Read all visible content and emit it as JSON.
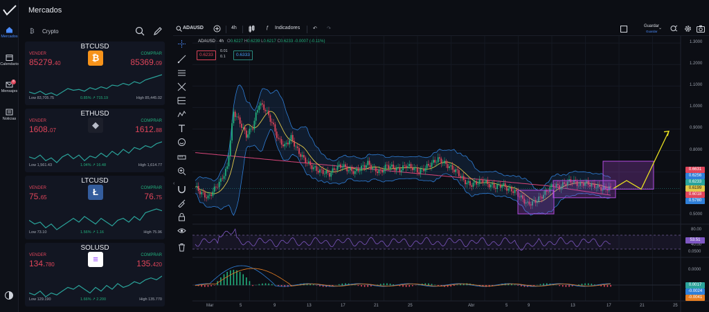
{
  "app": {
    "page_title": "Mercados"
  },
  "rail": {
    "items": [
      {
        "label": "Mercados",
        "icon": "home-icon",
        "active": true
      },
      {
        "label": "Calendario",
        "icon": "calendar-icon"
      },
      {
        "label": "Mensajes",
        "icon": "mail-icon",
        "badge": "8"
      },
      {
        "label": "Noticias",
        "icon": "news-icon"
      }
    ]
  },
  "panel": {
    "category_icon": "bitcoin-b-icon",
    "category_label": "Crypto",
    "cards": [
      {
        "symbol": "BTCUSD",
        "sell_label": "VENDER",
        "buy_label": "COMPRAR",
        "sell_main": "85279.",
        "sell_tail": "40",
        "buy_main": "85369.",
        "buy_tail": "09",
        "low": "Low 83,705.75",
        "change": "0.85% ↗ 715.19",
        "high": "High 85,445.02",
        "coin_color": "#f7931a",
        "coin_icon": "bitcoin-icon",
        "spark": [
          30,
          32,
          29,
          33,
          31,
          34,
          30,
          26,
          28,
          27,
          29,
          25,
          27,
          24,
          26,
          22,
          23,
          20,
          22,
          18,
          20,
          16,
          14,
          12,
          10
        ]
      },
      {
        "symbol": "ETHUSD",
        "sell_label": "VENDER",
        "buy_label": "COMPRAR",
        "sell_main": "1608.",
        "sell_tail": "07",
        "buy_main": "1612.",
        "buy_tail": "88",
        "low": "Low 1,561.43",
        "change": "1.04% ↗ 16.48",
        "high": "High 1,614.77",
        "coin_color": "#1c1f2a",
        "coin_icon": "ethereum-icon",
        "spark": [
          26,
          28,
          24,
          30,
          27,
          32,
          26,
          23,
          28,
          24,
          30,
          25,
          27,
          22,
          26,
          20,
          24,
          18,
          22,
          16,
          18,
          14,
          16,
          12,
          10
        ]
      },
      {
        "symbol": "LTCUSD",
        "sell_label": "VENDER",
        "buy_label": "COMPRAR",
        "sell_main": "75.",
        "sell_tail": "65",
        "buy_main": "76.",
        "buy_tail": "75",
        "low": "Low 73.10",
        "change": "1.56% ↗ 1.16",
        "high": "High 75.96",
        "coin_color": "#345d9d",
        "coin_icon": "litecoin-icon",
        "spark": [
          22,
          26,
          24,
          30,
          26,
          32,
          28,
          24,
          20,
          24,
          18,
          22,
          26,
          20,
          24,
          28,
          22,
          20,
          24,
          18,
          22,
          14,
          12,
          10,
          12
        ]
      },
      {
        "symbol": "SOLUSD",
        "sell_label": "VENDER",
        "buy_label": "COMPRAR",
        "sell_main": "134.",
        "sell_tail": "780",
        "buy_main": "135.",
        "buy_tail": "420",
        "low": "Low 129.190",
        "change": "1.66% ↗ 2.200",
        "high": "High 135.770",
        "coin_color": "#ffffff",
        "coin_icon": "solana-icon",
        "spark": [
          28,
          30,
          26,
          32,
          28,
          30,
          26,
          22,
          24,
          20,
          24,
          28,
          22,
          26,
          20,
          24,
          18,
          22,
          20,
          16,
          18,
          14,
          12,
          14,
          10
        ]
      }
    ]
  },
  "toolbar": {
    "symbol": "ADAUSD",
    "interval": "4h",
    "indicators_label": "Indicadores",
    "save_label": "Guardar",
    "save_sub": "Guardar"
  },
  "chart_header": {
    "title": "ADAUSD · 4h",
    "o_label": "O",
    "o_value": "0.6227",
    "h_label": "H",
    "h_value": "0.6239",
    "l_label": "L",
    "l_value": "0.6217",
    "c_label": "C",
    "c_value": "0.6233",
    "change": "-0.0007 (-0.11%)",
    "sell_quote": "0.6233",
    "buy_quote": "0.6333",
    "spread_top": "0.01",
    "spread_bottom": "0.1"
  },
  "price_axis": {
    "ticks": [
      "1.3000",
      "1.2000",
      "1.1000",
      "1.0000",
      "0.9000",
      "0.8000",
      "0.7000",
      "0.6000",
      "0.5000"
    ],
    "tags": [
      {
        "value": "0.6631",
        "bg": "#e0455a",
        "fg": "#ffffff"
      },
      {
        "value": "0.6256",
        "bg": "#2f7fd8",
        "fg": "#ffffff"
      },
      {
        "value": "0.6233",
        "bg": "#2aa39a",
        "fg": "#ffffff"
      },
      {
        "value": "0.6199",
        "bg": "#e3c94a",
        "fg": "#1a1a1a"
      },
      {
        "value": "0.6018",
        "bg": "#e0455a",
        "fg": "#ffffff"
      },
      {
        "value": "0.5780",
        "bg": "#2f7fd8",
        "fg": "#ffffff"
      }
    ]
  },
  "rsi_axis": {
    "ticks": [
      "80.00",
      "40.00"
    ],
    "tag": {
      "value": "53.51",
      "bg": "#7e57c2",
      "fg": "#ffffff"
    }
  },
  "macd_axis": {
    "ticks": [
      "0.0500",
      "0.0000"
    ],
    "tags": [
      {
        "value": "0.0017",
        "bg": "#2aa39a",
        "fg": "#ffffff"
      },
      {
        "value": "-0.0024",
        "bg": "#2f7fd8",
        "fg": "#ffffff"
      },
      {
        "value": "-0.0041",
        "bg": "#e67e22",
        "fg": "#ffffff"
      }
    ]
  },
  "time_axis": {
    "labels": [
      "Mar",
      "5",
      "9",
      "13",
      "17",
      "21",
      "25",
      "Abr",
      "5",
      "9",
      "13",
      "17",
      "21",
      "25"
    ]
  },
  "chart_data": {
    "type": "candlestick",
    "colors": {
      "up": "#22b07d",
      "down": "#e0455a",
      "ma_slow": "#d9467a",
      "ma_fast": "#e3c94a",
      "band": "#2f7fd8",
      "rsi": "#7e57c2",
      "macd": "#2f7fd8",
      "signal": "#e67e22",
      "forecast": "#e8e020",
      "zones": "#b24ce0"
    },
    "y_range": [
      0.47,
      1.32
    ],
    "close_path": [
      0.63,
      0.6,
      0.58,
      0.62,
      0.66,
      0.72,
      0.98,
      0.93,
      0.87,
      0.91,
      1.02,
      0.99,
      0.93,
      0.85,
      0.82,
      0.86,
      0.8,
      0.76,
      0.73,
      0.71,
      0.7,
      0.69,
      0.72,
      0.73,
      0.71,
      0.7,
      0.72,
      0.74,
      0.71,
      0.7,
      0.73,
      0.72,
      0.71,
      0.73,
      0.72,
      0.7,
      0.72,
      0.74,
      0.76,
      0.74,
      0.72,
      0.7,
      0.66,
      0.64,
      0.65,
      0.66,
      0.64,
      0.63,
      0.64,
      0.62,
      0.61,
      0.58,
      0.55,
      0.56,
      0.58,
      0.61,
      0.64,
      0.63,
      0.65,
      0.66,
      0.64,
      0.65,
      0.64,
      0.63,
      0.62,
      0.63
    ],
    "forecast_path": [
      0.623,
      0.66,
      0.62,
      0.89
    ]
  }
}
